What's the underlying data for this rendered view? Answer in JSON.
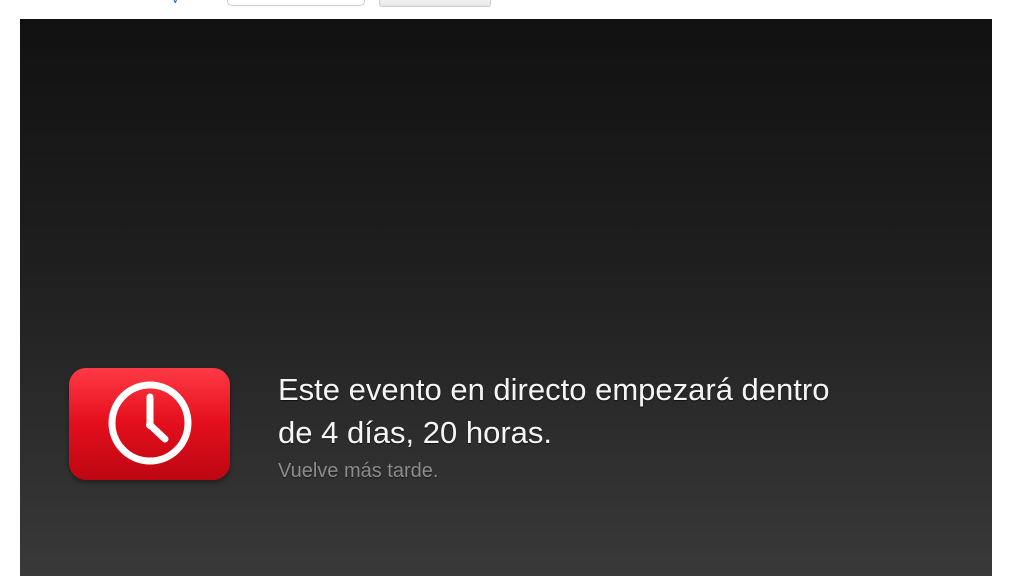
{
  "top_toolbar": {
    "link_fragment": "y"
  },
  "live_event": {
    "headline_line1": "Este evento en directo empezará dentro",
    "headline_line2": "de 4 días, 20 horas.",
    "subline": "Vuelve más tarde.",
    "icon": "clock-icon",
    "colors": {
      "badge": "#e50f1d",
      "background_top": "#111111",
      "background_bottom": "#393939",
      "headline": "#f5f5f5",
      "subline": "#8c8c8c"
    }
  }
}
